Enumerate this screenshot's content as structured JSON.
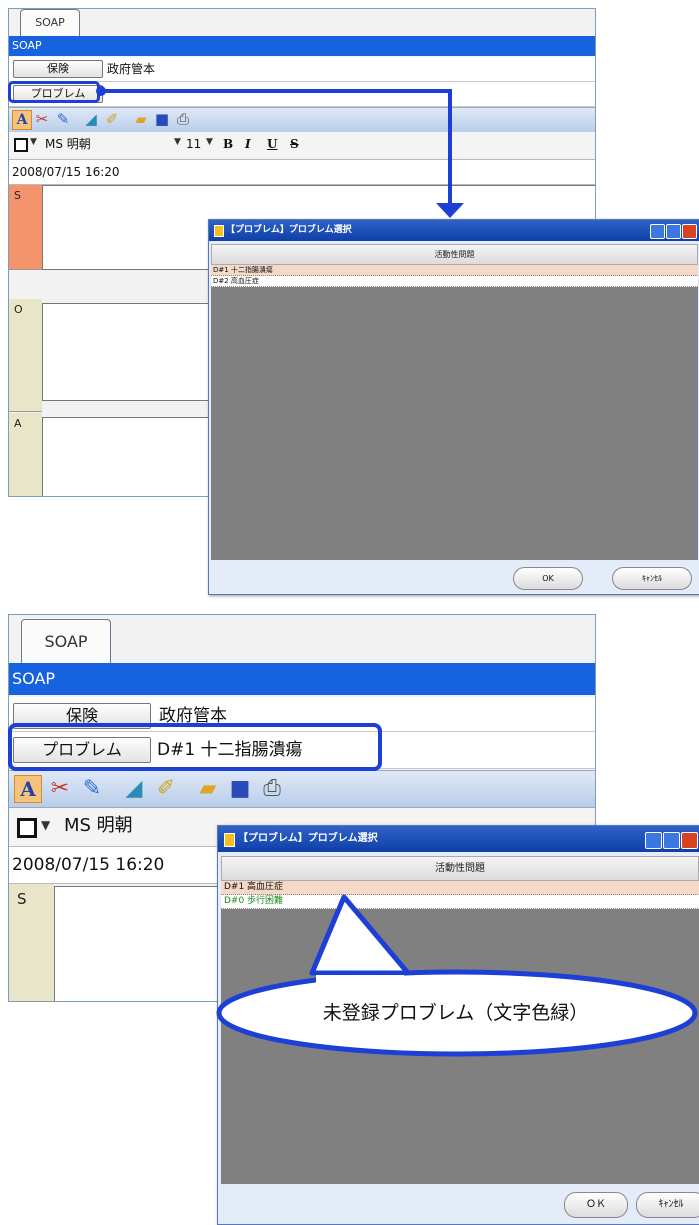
{
  "top_window": {
    "tab_label": "SOAP",
    "band_label": "SOAP",
    "insurance_button": "保険",
    "insurance_value": "政府管本",
    "problem_button": "プロブレム",
    "font_name": "MS 明朝",
    "font_size": "11",
    "format_bold": "B",
    "format_italic": "I",
    "format_underline": "U",
    "format_strike": "S",
    "datetime": "2008/07/15 16:20",
    "sections": [
      "S",
      "O",
      "A"
    ]
  },
  "top_dialog": {
    "title": "【プロブレム】プロブレム選択",
    "column_header": "活動性問題",
    "rows": [
      "D#1 十二指腸潰瘍",
      "D#2 高血圧症"
    ],
    "ok_label": "OK",
    "cancel_label": "ｷｬﾝｾﾙ"
  },
  "bottom_window": {
    "tab_label": "SOAP",
    "band_label": "SOAP",
    "insurance_button": "保険",
    "insurance_value": "政府管本",
    "problem_button": "プロブレム",
    "problem_value": "D#1 十二指腸潰瘍",
    "font_name": "MS 明朝",
    "datetime": "2008/07/15 16:20",
    "section": "S"
  },
  "bottom_dialog": {
    "title": "【プロブレム】プロブレム選択",
    "column_header": "活動性問題",
    "rows": [
      "D#1 高血圧症",
      "D#0 歩行困難"
    ],
    "ok_label": "ＯＫ",
    "cancel_label": "ｷｬﾝｾﾙ"
  },
  "callout_text": "未登録プロブレム（文字色緑）",
  "colors": {
    "accent_blue": "#1763df",
    "highlight_outline": "#1c3fd8",
    "unregistered_green": "#1e8a1e",
    "selected_row": "#f6d8c6",
    "s_section": "#f3946c"
  }
}
